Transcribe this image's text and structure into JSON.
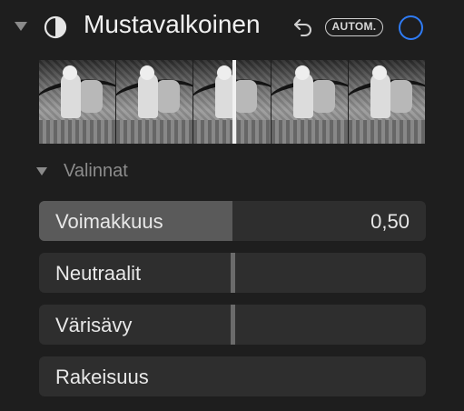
{
  "header": {
    "title": "Mustavalkoinen",
    "auto_label": "AUTOM.",
    "enabled": true,
    "accent_color": "#2f7cf6"
  },
  "previews": {
    "count": 5,
    "selected_index": 2
  },
  "options": {
    "label": "Valinnat"
  },
  "sliders": [
    {
      "label": "Voimakkuus",
      "value": "0,50",
      "fill_fraction": 0.5
    },
    {
      "label": "Neutraalit",
      "value": "",
      "fill_fraction": 0.5
    },
    {
      "label": "Värisävy",
      "value": "",
      "fill_fraction": 0.5
    },
    {
      "label": "Rakeisuus",
      "value": "",
      "fill_fraction": 0
    }
  ]
}
